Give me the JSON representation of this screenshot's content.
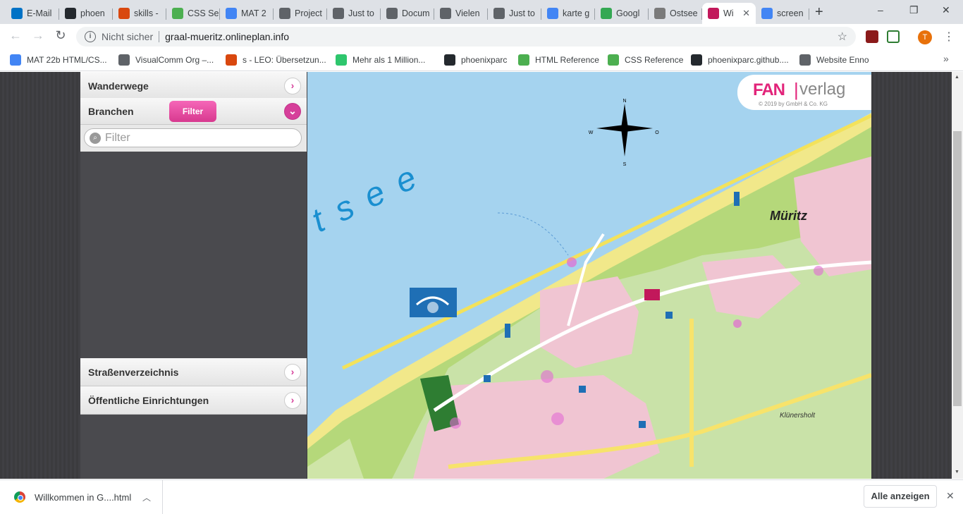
{
  "browser": {
    "tabs": [
      {
        "label": "E-Mail",
        "icon": "outlook-icon",
        "color": "#0072c6"
      },
      {
        "label": "phoen",
        "icon": "github-icon",
        "color": "#24292e"
      },
      {
        "label": "skills -",
        "icon": "leo-icon",
        "color": "#d9480f"
      },
      {
        "label": "CSS Se",
        "icon": "w3schools-icon",
        "color": "#4caf50"
      },
      {
        "label": "MAT 2",
        "icon": "google-docs-icon",
        "color": "#4285f4"
      },
      {
        "label": "Project",
        "icon": "globe-icon",
        "color": "#5f6368"
      },
      {
        "label": "Just to",
        "icon": "globe-icon",
        "color": "#5f6368"
      },
      {
        "label": "Docum",
        "icon": "globe-icon",
        "color": "#5f6368"
      },
      {
        "label": "Vielen",
        "icon": "globe-icon",
        "color": "#5f6368"
      },
      {
        "label": "Just to",
        "icon": "globe-icon",
        "color": "#5f6368"
      },
      {
        "label": "karte g",
        "icon": "google-icon",
        "color": "#4285f4"
      },
      {
        "label": "Googl",
        "icon": "google-maps-icon",
        "color": "#34a853"
      },
      {
        "label": "Ostsee",
        "icon": "shield-icon",
        "color": "#7a7a7a"
      },
      {
        "label": "Wi",
        "icon": "world-icon",
        "color": "#c2185b",
        "active": true
      },
      {
        "label": "screen",
        "icon": "google-icon",
        "color": "#4285f4"
      }
    ],
    "new_tab": "+",
    "window_controls": {
      "minimize": "–",
      "maximize": "❐",
      "close": "✕"
    },
    "omnibox": {
      "security": "Nicht sicher",
      "url": "graal-mueritz.onlineplan.info"
    },
    "profile_initial": "T",
    "bookmarks": [
      {
        "label": "MAT 22b HTML/CS...",
        "icon": "google-docs-icon",
        "color": "#4285f4"
      },
      {
        "label": "VisualComm Org –...",
        "icon": "globe-icon",
        "color": "#5f6368"
      },
      {
        "label": "s - LEO: Übersetzun...",
        "icon": "leo-icon",
        "color": "#d9480f"
      },
      {
        "label": "Mehr als 1 Million...",
        "icon": "pixabay-icon",
        "color": "#2ec66d"
      },
      {
        "label": "phoenixparc",
        "icon": "github-icon",
        "color": "#24292e"
      },
      {
        "label": "HTML Reference",
        "icon": "w3schools-icon",
        "color": "#4caf50"
      },
      {
        "label": "CSS Reference",
        "icon": "w3schools-icon",
        "color": "#4caf50"
      },
      {
        "label": "phoenixparc.github....",
        "icon": "github-icon",
        "color": "#24292e"
      },
      {
        "label": "Website Enno",
        "icon": "globe-icon",
        "color": "#5f6368"
      }
    ],
    "bookmarks_more": "»"
  },
  "sidebar": {
    "wanderwege": "Wanderwege",
    "branchen": "Branchen",
    "filter_button": "Filter",
    "filter_placeholder": "Filter",
    "strassen": "Straßenverzeichnis",
    "oeffentliche": "Öffentliche Einrichtungen"
  },
  "map": {
    "sea_label": "tsee",
    "logo_fan": "FAN",
    "logo_verlag": "verlag",
    "logo_sub": "© 2019 by  GmbH & Co. KG",
    "compass": {
      "n": "N",
      "s": "S",
      "w": "W",
      "e": "O"
    },
    "place_labels": {
      "mueritz": "Müritz",
      "kluenersholt": "Klünersholt"
    }
  },
  "downloads": {
    "item": "Willkommen in G....html",
    "show_all": "Alle anzeigen"
  }
}
